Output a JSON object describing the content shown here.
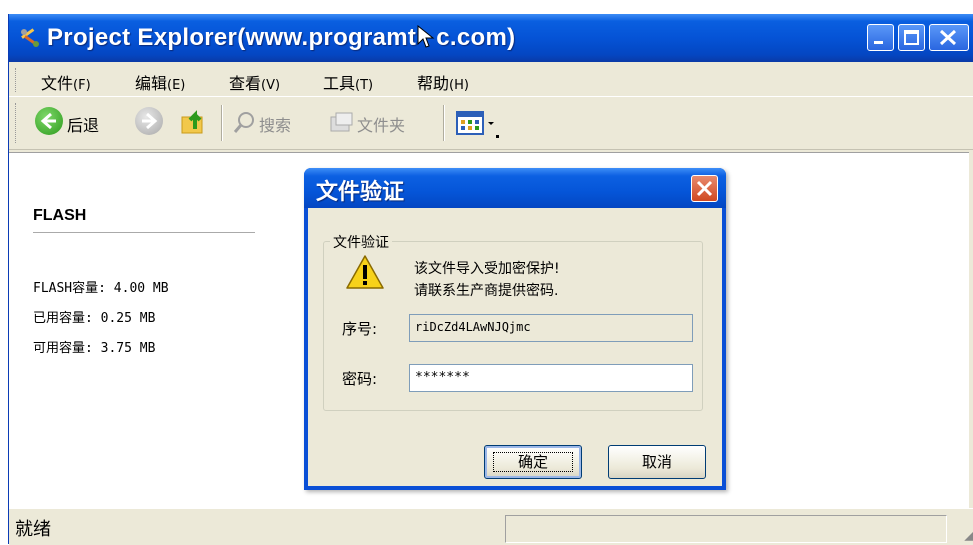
{
  "window": {
    "title": "Project Explorer(www.programt",
    "title_tail": "c.com)",
    "icon": "wrench-app-icon"
  },
  "menu": [
    {
      "label": "文件",
      "mnemonic": "(F)"
    },
    {
      "label": "编辑",
      "mnemonic": "(E)"
    },
    {
      "label": "查看",
      "mnemonic": "(V)"
    },
    {
      "label": "工具",
      "mnemonic": "(T)"
    },
    {
      "label": "帮助",
      "mnemonic": "(H)"
    }
  ],
  "toolbar": {
    "back": "后退",
    "search": "搜索",
    "folders": "文件夹"
  },
  "panel": {
    "title": "FLASH",
    "rows": [
      {
        "label": "FLASH容量:",
        "value": "4.00 MB"
      },
      {
        "label": "已用容量:",
        "value": "0.25 MB"
      },
      {
        "label": "可用容量:",
        "value": "3.75 MB"
      }
    ]
  },
  "status": {
    "text": "就绪"
  },
  "dialog": {
    "title": "文件验证",
    "group_label": "文件验证",
    "message_line1": "该文件导入受加密保护!",
    "message_line2": "请联系生产商提供密码.",
    "serial_label": "序号:",
    "serial_value": "riDcZd4LAwNJQjmc",
    "password_label": "密码:",
    "password_value": "*******",
    "ok_label": "确定",
    "cancel_label": "取消"
  },
  "colors": {
    "titlebar": "#0553d6",
    "window_bg": "#ece9d8",
    "close_button": "#d04820"
  }
}
